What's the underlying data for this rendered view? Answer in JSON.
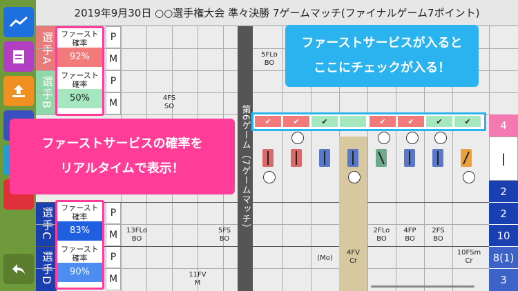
{
  "title": "2019年9月30日 ○○選手権大会 準々決勝 7ゲームマッチ(ファイナルゲーム7ポイント)",
  "game_label": "第6ゲーム（7ゲームマッチ）",
  "players": [
    {
      "label": "選手A",
      "rate_head": "ファースト確率",
      "rate": "92%",
      "rate_color": "#f27a7a"
    },
    {
      "label": "選手B",
      "rate_head": "ファースト確率",
      "rate": "50%",
      "rate_color": "#a5e8c0"
    },
    {
      "label": "選手C",
      "rate_head": "ファースト確率",
      "rate": "83%",
      "rate_color": "#1f5fe0"
    },
    {
      "label": "選手D",
      "rate_head": "ファースト確率",
      "rate": "90%",
      "rate_color": "#4d8cf0"
    }
  ],
  "p_label": "P",
  "m_label": "M",
  "cells": {
    "a_5flo": "5FLo\nBO",
    "b_4fs": "4FS\nSO",
    "c_13flo": "13FLo\nBO",
    "c_5fs": "5FS\nBO",
    "c_2flo": "2FLo\nBO",
    "c_4fp": "4FP\nBO",
    "c_2fs": "2FS\nBO",
    "d_11fv": "11FV\nM",
    "d_mo": "(Mo)",
    "d_4fv": "4FV\nCr",
    "d_10fsm": "10FSm\nCr"
  },
  "scores": [
    "4",
    "|",
    "2",
    "2",
    "10",
    "8(1)",
    "3"
  ],
  "check_mark": "✔",
  "callout_top": "ファーストサービスが入ると\nここにチェックが入る！",
  "callout_left": "ファーストサービスの確率を\nリアルタイムで表示！",
  "colors": {
    "accent": "#ff3d98",
    "cyan": "#2bb3f0",
    "navy": "#1a3fb0"
  }
}
